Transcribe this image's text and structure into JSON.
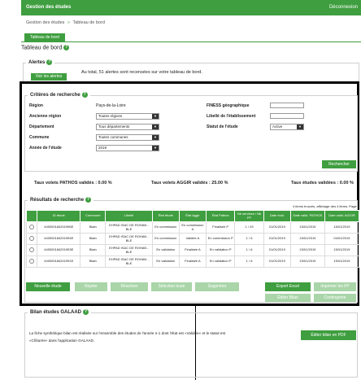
{
  "header": {
    "title": "Gestion des études",
    "logout": "Déconnexion"
  },
  "breadcrumb": {
    "root": "Gestion des études",
    "separator": "»",
    "current": "Tableau de bord"
  },
  "tab": {
    "label": "Tableau de bord"
  },
  "page_title": "Tableau de bord",
  "alertes": {
    "legend": "Alertes",
    "button": "Voir les alertes",
    "text": "Au total, 51 alertes sont recensées sur votre tableau de bord."
  },
  "criteres": {
    "legend": "Critères de recherche",
    "region_label": "Région",
    "region_value": "Pays-de-la-Loire",
    "ancienne_region_label": "Ancienne région",
    "ancienne_region_value": "Toutes régions",
    "departement_label": "Département",
    "departement_value": "Tous départements",
    "commune_label": "Commune",
    "commune_value": "Toutes communes",
    "annee_label": "Année de l'étude",
    "annee_value": "2019",
    "finess_label": "FINESS géographique",
    "libelle_label": "Libellé de l'établissement",
    "statut_label": "Statut de l'étude",
    "statut_value": "Active",
    "search_button": "Rechercher"
  },
  "rates": {
    "pathos": "Taux volets PATHOS validés : 0.00 %",
    "aggir": "Taux volets AGGIR validés : 25.00 %",
    "etudes": "Taux études validées : 0.00 %"
  },
  "resultats": {
    "legend": "Résultats de recherche",
    "count_text": "4 items trouvés, affichage des 4 items. Page 1",
    "columns": [
      "",
      "ID étude",
      "Commune",
      "Libellé",
      "État étude",
      "État Aggir",
      "État Pathos",
      "Nb services / Nb FP",
      "Date éval.",
      "Date valid. PATHOS",
      "Date valid. AGGIR"
    ],
    "rows": [
      [
        "",
        "440000184201996E",
        "Blain",
        "EHPAD ISAC DE ROHAN - BLE",
        "En commission",
        "En commission A",
        "Finalisée P",
        "1 / 29",
        "01/01/2019",
        "15/01/2019",
        "15/01/2019"
      ],
      [
        "",
        "440000184201994E",
        "Blain",
        "EHPAD ISAC DE ROHAN - BLE",
        "En commission",
        "Validée A",
        "En commission P",
        "1 / 6",
        "01/01/2019",
        "15/01/2019",
        "04/01/2019"
      ],
      [
        "",
        "440000184201993E",
        "Blain",
        "EHPAD ISAC DE ROHAN - BLE",
        "En validation",
        "Finalisée A",
        "En validation P",
        "1 / 6",
        "01/01/2019",
        "15/01/2019",
        "15/01/2019"
      ],
      [
        "",
        "440000184201991E",
        "Blain",
        "EHPAD ISAC DE ROHAN - BLE",
        "En validation",
        "Finalisée A",
        "En validation P",
        "1 / 6",
        "01/01/2019",
        "15/01/2019",
        "15/01/2019"
      ]
    ],
    "buttons": {
      "nouvelle": "Nouvelle étude",
      "rejeter": "Rejeter",
      "reactiver": "Réactiver",
      "selection": "Sélection toute",
      "supprimer": "Supprimer",
      "export": "Export Excel",
      "imprimer": "Imprimer les FP",
      "editer_bilan": "Éditer Bilan",
      "contingente": "Contingente"
    }
  },
  "bilan": {
    "legend": "Bilan études GALAAD",
    "text_line1": "La fiche synthétique bilan est réalisée sur l'ensemble des études de l'année n-1 dont l'état est «Validée» et le statut est",
    "text_line2": "«Clôturée» dans l'application GALAAD.",
    "button": "Éditer bilan en PDF"
  }
}
